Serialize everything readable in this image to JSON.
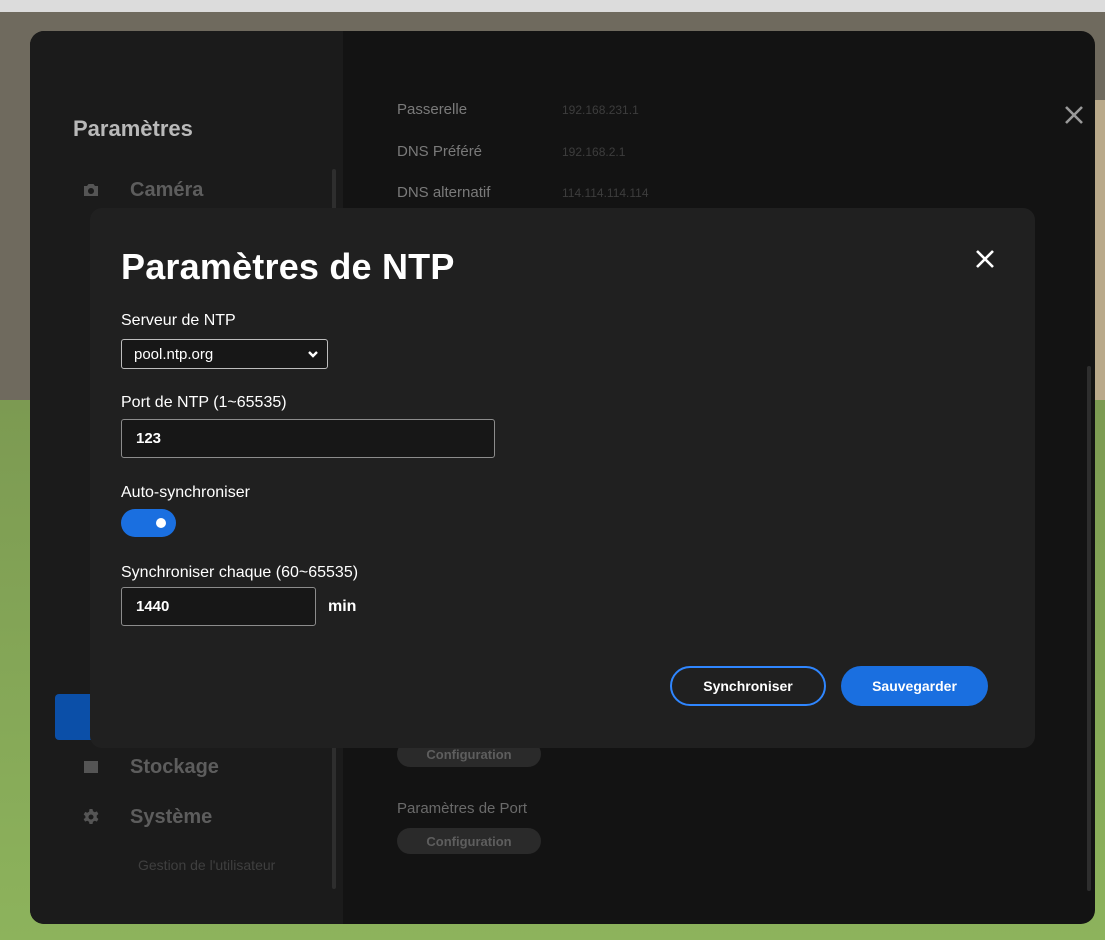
{
  "settings": {
    "title": "Paramètres",
    "sidebar": {
      "items": [
        {
          "label": "Caméra",
          "icon": "camera-icon"
        },
        {
          "label": "Stockage",
          "icon": "storage-icon"
        },
        {
          "label": "Système",
          "icon": "gear-icon"
        }
      ],
      "sub_item": "Gestion de l'utilisateur"
    },
    "network": {
      "rows": [
        {
          "label": "Passerelle",
          "value": "192.168.231.1"
        },
        {
          "label": "DNS Préféré",
          "value": "192.168.2.1"
        },
        {
          "label": "DNS alternatif",
          "value": "114.114.114.114"
        }
      ],
      "config_button": "Configuration",
      "port_section": "Paramètres de Port"
    }
  },
  "modal": {
    "title": "Paramètres de NTP",
    "server_label": "Serveur de NTP",
    "server_value": "pool.ntp.org",
    "port_label": "Port de NTP (1~65535)",
    "port_value": "123",
    "auto_sync_label": "Auto-synchroniser",
    "auto_sync_on": true,
    "interval_label": "Synchroniser chaque (60~65535)",
    "interval_value": "1440",
    "interval_unit": "min",
    "sync_button": "Synchroniser",
    "save_button": "Sauvegarder"
  },
  "colors": {
    "accent": "#1a6fe0",
    "modal_bg": "#202020",
    "window_bg": "#131313"
  }
}
